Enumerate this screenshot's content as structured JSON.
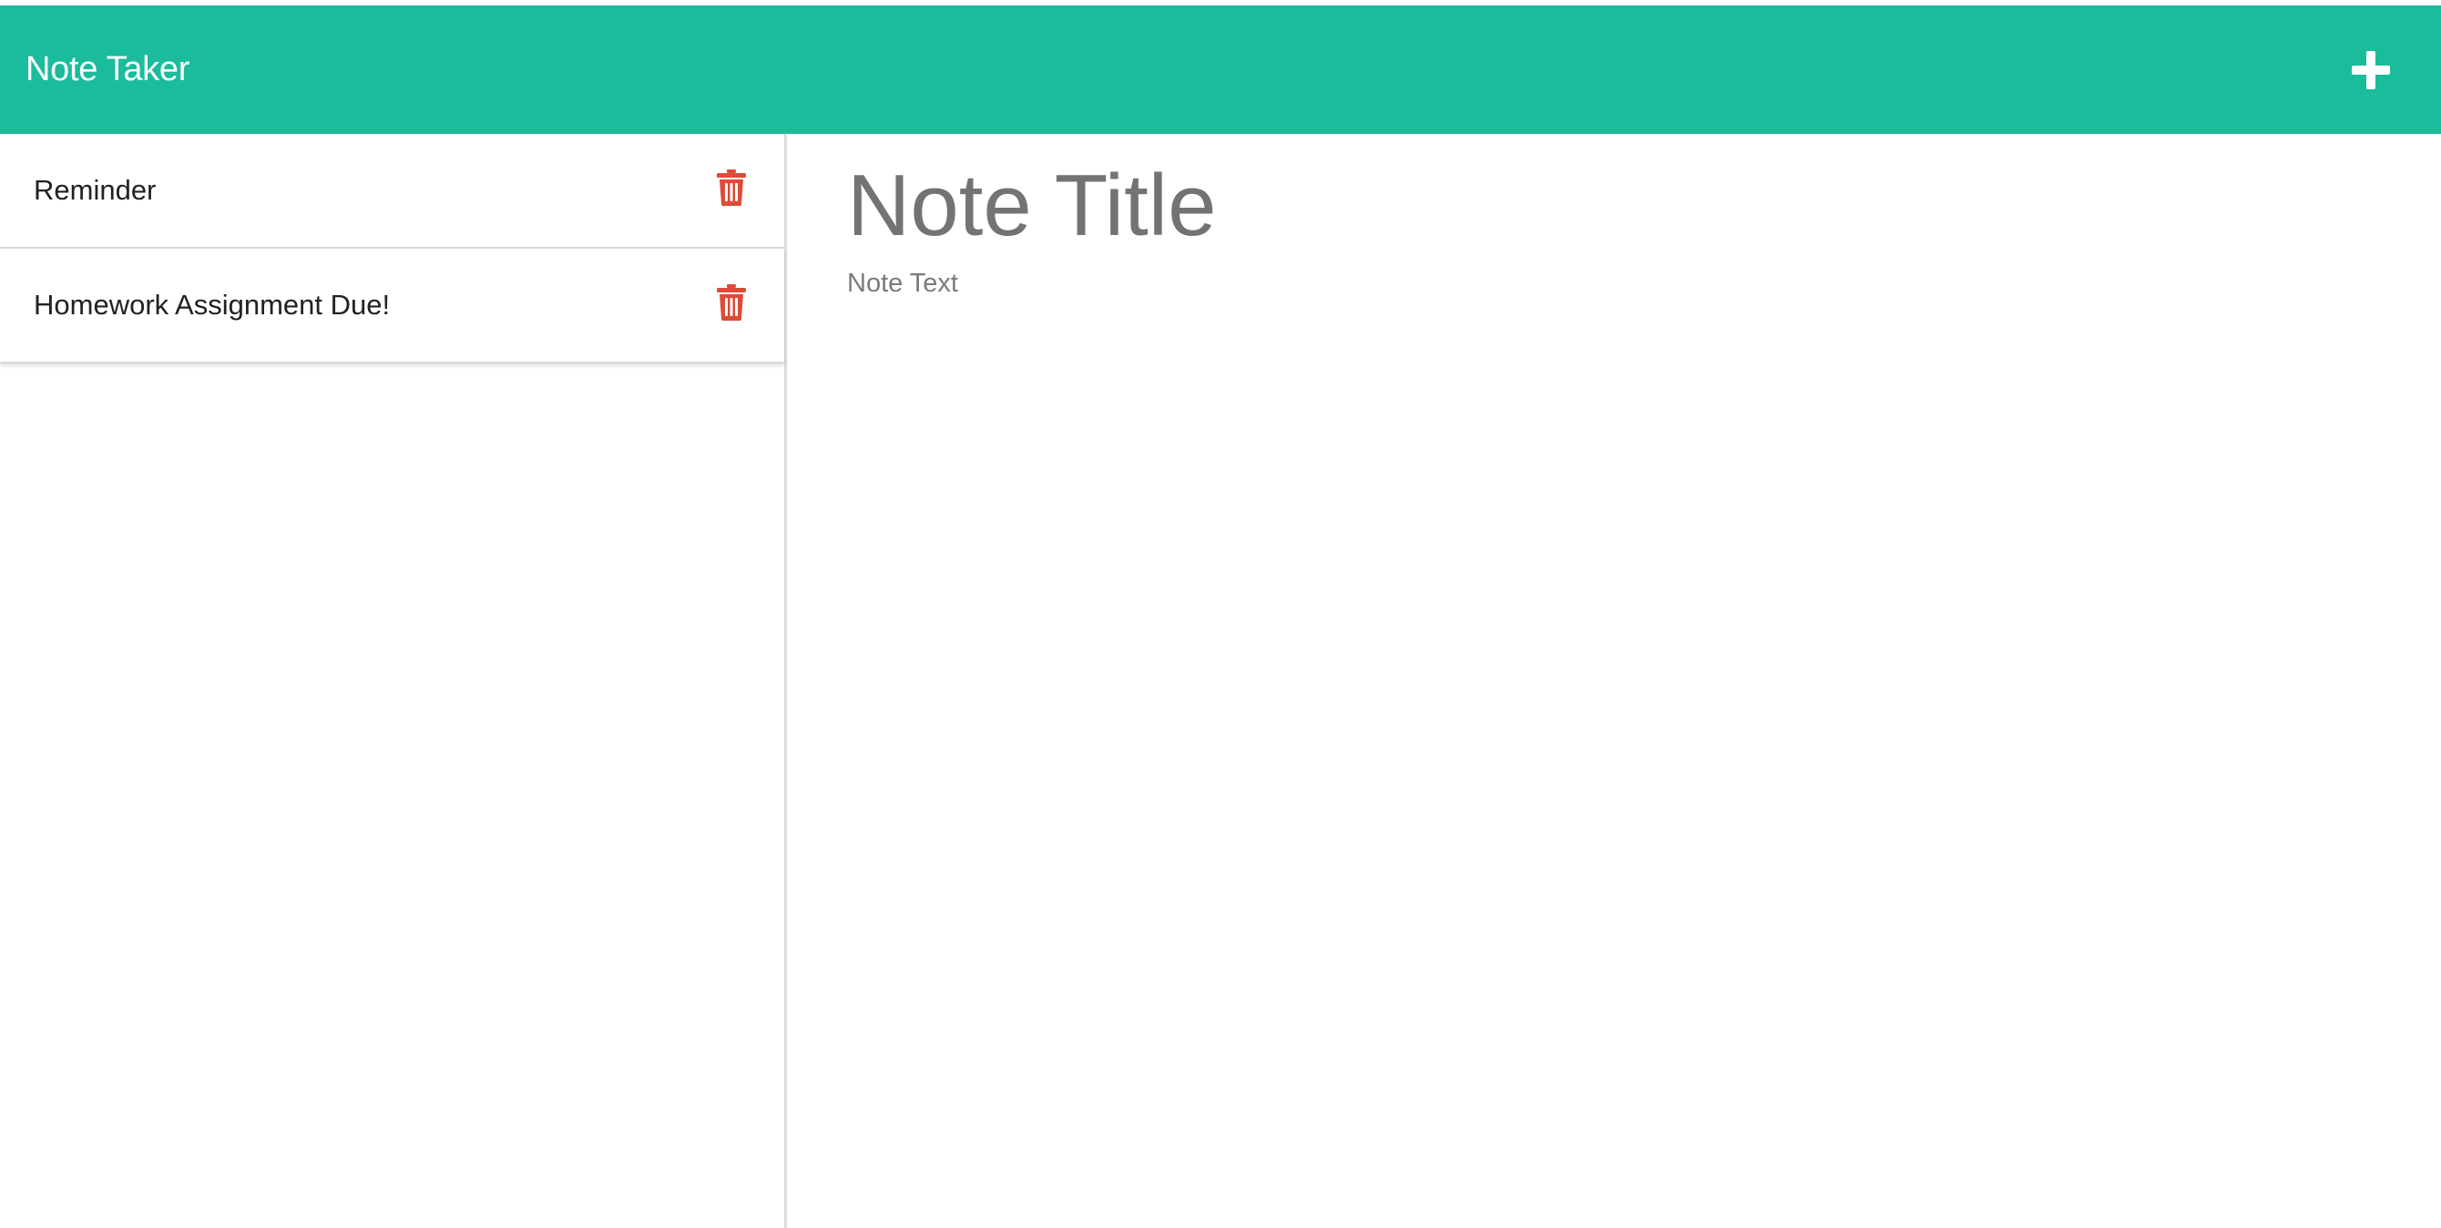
{
  "colors": {
    "navbar": "#1abc9c",
    "delete_icon": "#dd4b39",
    "title_placeholder": "#737373"
  },
  "navbar": {
    "title": "Note Taker",
    "new_note_icon": "plus-icon"
  },
  "sidebar": {
    "notes": [
      {
        "title": "Reminder",
        "delete_icon": "trash-icon"
      },
      {
        "title": "Homework Assignment Due!",
        "delete_icon": "trash-icon"
      }
    ]
  },
  "editor": {
    "title_placeholder": "Note Title",
    "text_placeholder": "Note Text",
    "title_value": "",
    "text_value": ""
  }
}
